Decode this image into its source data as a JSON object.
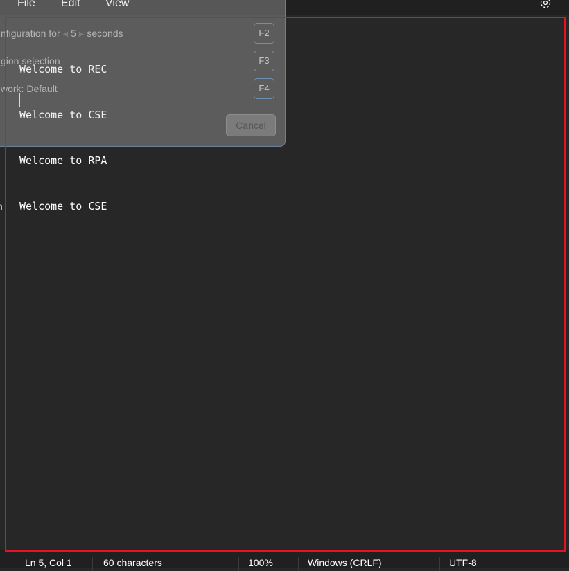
{
  "menu": {
    "items": [
      "File",
      "Edit",
      "View"
    ],
    "settings_icon": "gear-icon"
  },
  "editor": {
    "lines": [
      "Welcome to REC",
      "Welcome to CSE",
      "Welcome to RPA",
      "Welcome to CSE"
    ]
  },
  "snip_overlay": {
    "row1_left": "nfiguration for",
    "delay_value": "5",
    "row1_right": "seconds",
    "row2": "gion selection",
    "row3": "work: Default",
    "keys": [
      "F2",
      "F3",
      "F4"
    ],
    "cancel_label": "Cancel",
    "stub": "n"
  },
  "status": {
    "position": "Ln 5, Col 1",
    "characters": "60 characters",
    "zoom": "100%",
    "line_ending": "Windows (CRLF)",
    "encoding": "UTF-8"
  },
  "colors": {
    "frame": "#e81123",
    "editor_bg": "#272727",
    "bar_bg": "#202020"
  }
}
